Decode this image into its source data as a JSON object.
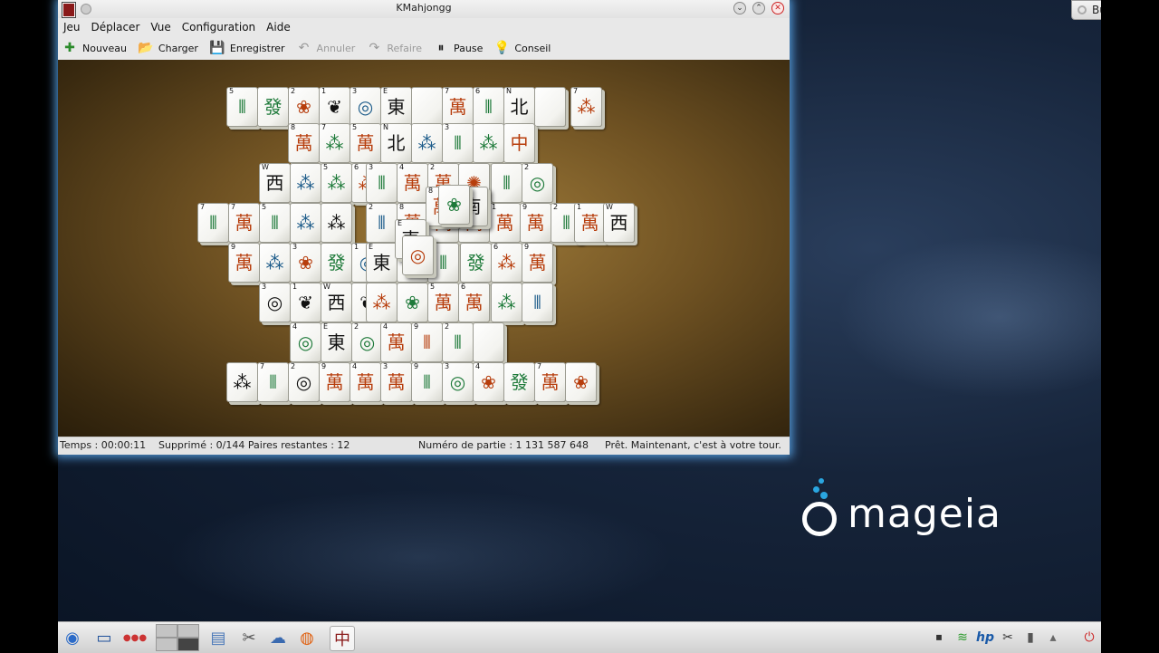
{
  "window": {
    "title": "KMahjongg",
    "controls": {
      "minimize": "⌄",
      "maximize": "⌃",
      "close": "✕"
    }
  },
  "menu": [
    "Jeu",
    "Déplacer",
    "Vue",
    "Configuration",
    "Aide"
  ],
  "toolbar": [
    {
      "label": "Nouveau",
      "icon": "new-game-icon",
      "glyph": "✚",
      "enabled": true
    },
    {
      "label": "Charger",
      "icon": "folder-open-icon",
      "glyph": "📂",
      "enabled": true
    },
    {
      "label": "Enregistrer",
      "icon": "save-icon",
      "glyph": "💾",
      "enabled": true
    },
    {
      "label": "Annuler",
      "icon": "undo-icon",
      "glyph": "↶",
      "enabled": false
    },
    {
      "label": "Refaire",
      "icon": "redo-icon",
      "glyph": "↷",
      "enabled": false
    },
    {
      "label": "Pause",
      "icon": "pause-icon",
      "glyph": "⏸",
      "enabled": true
    },
    {
      "label": "Conseil",
      "icon": "hint-bulb-icon",
      "glyph": "💡",
      "enabled": true
    }
  ],
  "status": {
    "time": "Temps : 00:00:11",
    "removed": "Supprimé : 0/144 Paires restantes : 12",
    "game_number": "Numéro de partie : 1 131 587 648",
    "message": "Prêt. Maintenant, c'est à votre tour."
  },
  "desktop": {
    "bureau_label": "Bureau",
    "logo_text": "mageia"
  },
  "colors": {
    "accent_glow": "#5aaaf0",
    "tile_red": "#b73d0c",
    "tile_green": "#1e7a3a",
    "tile_blue": "#1d5c8a"
  },
  "tiles": [
    {
      "n": "5",
      "g": "⦀",
      "c": "grn"
    },
    {
      "n": "",
      "g": "發",
      "c": "grn"
    },
    {
      "n": "2",
      "g": "❀",
      "c": "red"
    },
    {
      "n": "1",
      "g": "❦",
      "c": "blk"
    },
    {
      "n": "3",
      "g": "◎",
      "c": "blu"
    },
    {
      "n": "E",
      "g": "東",
      "c": "blk"
    },
    {
      "n": "",
      "g": "",
      "c": "blk"
    },
    {
      "n": "7",
      "g": "萬",
      "c": "red"
    },
    {
      "n": "6",
      "g": "⦀",
      "c": "grn"
    },
    {
      "n": "N",
      "g": "北",
      "c": "blk"
    },
    {
      "n": "",
      "g": "",
      "c": "blk"
    },
    {
      "n": "7",
      "g": "⁂",
      "c": "red"
    },
    {
      "n": "8",
      "g": "萬",
      "c": "red"
    },
    {
      "n": "7",
      "g": "⁂",
      "c": "grn"
    },
    {
      "n": "5",
      "g": "萬",
      "c": "red"
    },
    {
      "n": "N",
      "g": "北",
      "c": "blk"
    },
    {
      "n": "",
      "g": "⁂",
      "c": "blu"
    },
    {
      "n": "3",
      "g": "⦀",
      "c": "grn"
    },
    {
      "n": "",
      "g": "⁂",
      "c": "grn"
    },
    {
      "n": "",
      "g": "中",
      "c": "red"
    },
    {
      "n": "W",
      "g": "西",
      "c": "blk"
    },
    {
      "n": "",
      "g": "⁂",
      "c": "blu"
    },
    {
      "n": "5",
      "g": "⁂",
      "c": "grn"
    },
    {
      "n": "6",
      "g": "⁂",
      "c": "red"
    },
    {
      "n": "3",
      "g": "⦀",
      "c": "grn"
    },
    {
      "n": "4",
      "g": "萬",
      "c": "red"
    },
    {
      "n": "2",
      "g": "萬",
      "c": "red"
    },
    {
      "n": "",
      "g": "✺",
      "c": "red"
    },
    {
      "n": "",
      "g": "⦀",
      "c": "grn"
    },
    {
      "n": "2",
      "g": "◎",
      "c": "grn"
    },
    {
      "n": "7",
      "g": "⦀",
      "c": "grn"
    },
    {
      "n": "7",
      "g": "萬",
      "c": "red"
    },
    {
      "n": "5",
      "g": "⦀",
      "c": "grn"
    },
    {
      "n": "",
      "g": "⁂",
      "c": "blu"
    },
    {
      "n": "",
      "g": "⁂",
      "c": "blk"
    },
    {
      "n": "2",
      "g": "⦀",
      "c": "blu"
    },
    {
      "n": "8",
      "g": "萬",
      "c": "red"
    },
    {
      "n": "",
      "g": "萬",
      "c": "red"
    },
    {
      "n": "",
      "g": "萬",
      "c": "red"
    },
    {
      "n": "1",
      "g": "萬",
      "c": "red"
    },
    {
      "n": "9",
      "g": "萬",
      "c": "red"
    },
    {
      "n": "2",
      "g": "⦀",
      "c": "grn"
    },
    {
      "n": "1",
      "g": "萬",
      "c": "red"
    },
    {
      "n": "W",
      "g": "西",
      "c": "blk"
    },
    {
      "n": "9",
      "g": "萬",
      "c": "red"
    },
    {
      "n": "",
      "g": "⁂",
      "c": "blu"
    },
    {
      "n": "3",
      "g": "❀",
      "c": "red"
    },
    {
      "n": "",
      "g": "發",
      "c": "grn"
    },
    {
      "n": "1",
      "g": "◎",
      "c": "blu"
    },
    {
      "n": "E",
      "g": "東",
      "c": "blk"
    },
    {
      "n": "",
      "g": "◎",
      "c": "grn"
    },
    {
      "n": "8",
      "g": "⦀",
      "c": "grn"
    },
    {
      "n": "",
      "g": "發",
      "c": "grn"
    },
    {
      "n": "6",
      "g": "⁂",
      "c": "red"
    },
    {
      "n": "9",
      "g": "萬",
      "c": "red"
    },
    {
      "n": "3",
      "g": "◎",
      "c": "blk"
    },
    {
      "n": "1",
      "g": "❦",
      "c": "blk"
    },
    {
      "n": "W",
      "g": "西",
      "c": "blk"
    },
    {
      "n": "",
      "g": "❦",
      "c": "blk"
    },
    {
      "n": "",
      "g": "⁂",
      "c": "red"
    },
    {
      "n": "",
      "g": "❀",
      "c": "grn"
    },
    {
      "n": "5",
      "g": "萬",
      "c": "red"
    },
    {
      "n": "6",
      "g": "萬",
      "c": "red"
    },
    {
      "n": "",
      "g": "⁂",
      "c": "grn"
    },
    {
      "n": "",
      "g": "⦀",
      "c": "blu"
    },
    {
      "n": "4",
      "g": "◎",
      "c": "grn"
    },
    {
      "n": "E",
      "g": "東",
      "c": "blk"
    },
    {
      "n": "2",
      "g": "◎",
      "c": "grn"
    },
    {
      "n": "4",
      "g": "萬",
      "c": "red"
    },
    {
      "n": "9",
      "g": "⦀",
      "c": "red"
    },
    {
      "n": "2",
      "g": "⦀",
      "c": "grn"
    },
    {
      "n": "",
      "g": "",
      "c": "blk"
    },
    {
      "n": "",
      "g": "⁂",
      "c": "blk"
    },
    {
      "n": "7",
      "g": "⦀",
      "c": "grn"
    },
    {
      "n": "2",
      "g": "◎",
      "c": "blk"
    },
    {
      "n": "9",
      "g": "萬",
      "c": "red"
    },
    {
      "n": "4",
      "g": "萬",
      "c": "red"
    },
    {
      "n": "3",
      "g": "萬",
      "c": "red"
    },
    {
      "n": "9",
      "g": "⦀",
      "c": "grn"
    },
    {
      "n": "3",
      "g": "◎",
      "c": "grn"
    },
    {
      "n": "4",
      "g": "❀",
      "c": "red"
    },
    {
      "n": "",
      "g": "發",
      "c": "grn"
    },
    {
      "n": "7",
      "g": "萬",
      "c": "red"
    },
    {
      "n": "",
      "g": "❀",
      "c": "red"
    },
    {
      "n": "E",
      "g": "東",
      "c": "blk"
    },
    {
      "n": "8",
      "g": "萬",
      "c": "red"
    },
    {
      "n": "S",
      "g": "南",
      "c": "blk"
    },
    {
      "n": "",
      "g": "◎",
      "c": "red"
    },
    {
      "n": "",
      "g": "❀",
      "c": "grn"
    }
  ],
  "taskbar": {
    "launchers": [
      {
        "name": "app-menu-icon",
        "glyph": "◉"
      },
      {
        "name": "show-desktop-icon",
        "glyph": "▭"
      },
      {
        "name": "activities-icon",
        "glyph": "●●●"
      },
      {
        "name": "file-manager-icon",
        "glyph": "▤"
      },
      {
        "name": "system-settings-icon",
        "glyph": "✂"
      },
      {
        "name": "network-connection-icon",
        "glyph": "☁"
      },
      {
        "name": "firefox-icon",
        "glyph": "◍"
      },
      {
        "name": "kmahjongg-task-icon",
        "glyph": "中"
      }
    ],
    "tray": [
      {
        "name": "stop-icon",
        "glyph": "⏹"
      },
      {
        "name": "wifi-icon",
        "glyph": "≋"
      },
      {
        "name": "hp-printer-icon",
        "glyph": "hp"
      },
      {
        "name": "clipboard-icon",
        "glyph": "✂"
      },
      {
        "name": "battery-icon",
        "glyph": "▮"
      },
      {
        "name": "expand-tray-icon",
        "glyph": "▴"
      },
      {
        "name": "power-icon",
        "glyph": "⏻"
      }
    ]
  }
}
